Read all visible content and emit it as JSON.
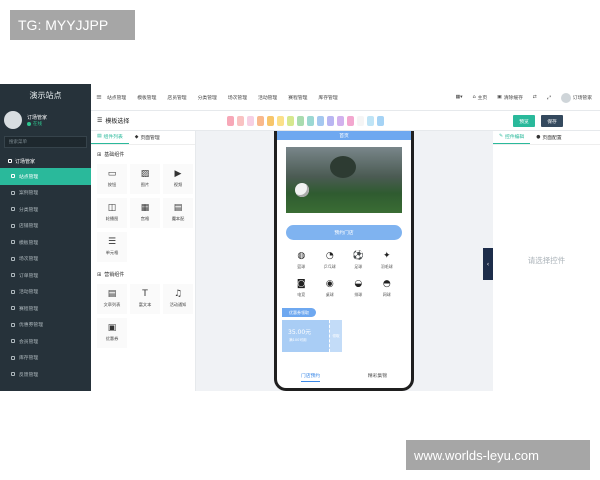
{
  "watermarks": {
    "top_left": "TG: MYYJJPP",
    "bottom_right": "www.worlds-leyu.com"
  },
  "sidebar": {
    "site_title": "演示站点",
    "user_name": "订场管家",
    "user_status": "在线",
    "search_placeholder": "搜索菜单",
    "group": "订场管家",
    "items": [
      {
        "label": "站点管理",
        "active": true
      },
      {
        "label": "案例管理"
      },
      {
        "label": "分类管理"
      },
      {
        "label": "店铺管理"
      },
      {
        "label": "模板管理"
      },
      {
        "label": "场次管理"
      },
      {
        "label": "订单管理"
      },
      {
        "label": "活动管理"
      },
      {
        "label": "赛程管理"
      },
      {
        "label": "优惠券管理"
      },
      {
        "label": "会员管理"
      },
      {
        "label": "库存管理"
      },
      {
        "label": "反馈管理"
      }
    ]
  },
  "topbar": {
    "menu_icon": "menu-icon",
    "items": [
      "站点管理",
      "模板管理",
      "店员管理",
      "分类管理",
      "场次管理",
      "活动管理",
      "赛程管理",
      "库存管理"
    ],
    "right": {
      "apps": "▦▾",
      "home": "主页",
      "clear_cache": "清除缓存",
      "user": "订场管家"
    }
  },
  "toolbar": {
    "title": "模板选择",
    "swatch_colors": [
      "#f7a8b8",
      "#f9c2c2",
      "#f6d0e4",
      "#f9b98c",
      "#f7c66b",
      "#fbe08a",
      "#d6e88f",
      "#a9dcb0",
      "#9bd8d3",
      "#a5c8f0",
      "#b9b6f2",
      "#d2b2ee",
      "#f3a7cf",
      "#f5f5f5",
      "#bfe4f6",
      "#a5d3f5"
    ],
    "preview_label": "预览",
    "save_label": "保存"
  },
  "palette": {
    "tabs": [
      "组件列表",
      "页面管理"
    ],
    "basic_title": "基础组件",
    "basic": [
      {
        "label": "按钮",
        "icon": "button-icon"
      },
      {
        "label": "图片",
        "icon": "image-icon"
      },
      {
        "label": "视频",
        "icon": "video-icon"
      },
      {
        "label": "轮播图",
        "icon": "carousel-icon"
      },
      {
        "label": "宫格",
        "icon": "grid-icon"
      },
      {
        "label": "魔本配",
        "icon": "magic-icon"
      },
      {
        "label": "单元格",
        "icon": "cell-icon"
      }
    ],
    "marketing_title": "营销组件",
    "marketing": [
      {
        "label": "文章列表",
        "icon": "article-icon"
      },
      {
        "label": "富文本",
        "icon": "rich-text-icon"
      },
      {
        "label": "活动通知",
        "icon": "bell-icon"
      },
      {
        "label": "优惠券",
        "icon": "coupon-icon"
      }
    ]
  },
  "phone": {
    "header": "首页",
    "book_label": "预约门店",
    "sports": [
      {
        "label": "篮球",
        "glyph": "◍"
      },
      {
        "label": "乒乓球",
        "glyph": "◔"
      },
      {
        "label": "足球",
        "glyph": "⚽"
      },
      {
        "label": "羽毛球",
        "glyph": "✦"
      },
      {
        "label": "电竞",
        "glyph": "◙"
      },
      {
        "label": "桌球",
        "glyph": "◉"
      },
      {
        "label": "排球",
        "glyph": "◒"
      },
      {
        "label": "网球",
        "glyph": "◓"
      }
    ],
    "coupon_head": "优惠券领取",
    "coupon_amount": "35.00元",
    "coupon_condition": "满100可用",
    "coupon_stub": "领取",
    "tabs": [
      "门店预约",
      "精彩集锦"
    ]
  },
  "props": {
    "tabs": [
      "控件编辑",
      "页面配置"
    ],
    "empty_hint": "请选择控件"
  }
}
